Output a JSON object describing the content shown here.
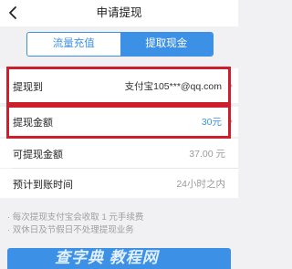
{
  "header": {
    "title": "申请提现"
  },
  "tabs": [
    {
      "label": "流量充值",
      "active": false
    },
    {
      "label": "提取现金",
      "active": true
    }
  ],
  "form": {
    "withdraw_to": {
      "label": "提现到",
      "value": "支付宝105***@qq.com"
    },
    "amount": {
      "label": "提现金额",
      "value": "30元"
    },
    "available": {
      "label": "可提现金额",
      "value": "37.00 元"
    },
    "eta": {
      "label": "预计到账时间",
      "value": "24小时之内"
    }
  },
  "notes": [
    "· 每次提现支付宝会收取 1 元手续费",
    "· 双休日及节假日不处理提现业务"
  ],
  "watermark": {
    "text": "查字典 教程网"
  },
  "colors": {
    "accent": "#3c91e6",
    "highlight": "#cc1f2b"
  }
}
